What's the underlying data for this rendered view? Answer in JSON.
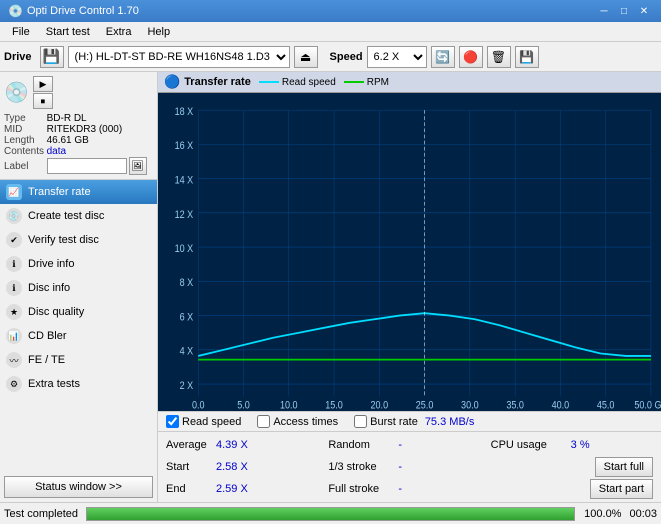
{
  "titlebar": {
    "title": "Opti Drive Control 1.70",
    "icon": "💿",
    "controls": [
      "—",
      "□",
      "✕"
    ]
  },
  "menubar": {
    "items": [
      "File",
      "Start test",
      "Extra",
      "Help"
    ]
  },
  "toolbar": {
    "drive_label": "Drive",
    "drive_value": "(H:) HL-DT-ST BD-RE  WH16NS48 1.D3",
    "speed_label": "Speed",
    "speed_value": "6.2 X"
  },
  "disc": {
    "type_label": "Type",
    "type_value": "BD-R DL",
    "mid_label": "MID",
    "mid_value": "RITEKDR3 (000)",
    "length_label": "Length",
    "length_value": "46.61 GB",
    "contents_label": "Contents",
    "contents_value": "data",
    "label_label": "Label",
    "label_value": ""
  },
  "nav": {
    "items": [
      {
        "id": "transfer-rate",
        "label": "Transfer rate",
        "active": true
      },
      {
        "id": "create-test-disc",
        "label": "Create test disc",
        "active": false
      },
      {
        "id": "verify-test-disc",
        "label": "Verify test disc",
        "active": false
      },
      {
        "id": "drive-info",
        "label": "Drive info",
        "active": false
      },
      {
        "id": "disc-info",
        "label": "Disc info",
        "active": false
      },
      {
        "id": "disc-quality",
        "label": "Disc quality",
        "active": false
      },
      {
        "id": "cd-bler",
        "label": "CD Bler",
        "active": false
      },
      {
        "id": "fe-te",
        "label": "FE / TE",
        "active": false
      },
      {
        "id": "extra-tests",
        "label": "Extra tests",
        "active": false
      }
    ],
    "status_btn": "Status window >>"
  },
  "chart": {
    "title": "Transfer rate",
    "legend": [
      {
        "label": "Read speed",
        "color": "#00ddff"
      },
      {
        "label": "RPM",
        "color": "#00cc00"
      }
    ],
    "y_axis": [
      "18 X",
      "16 X",
      "14 X",
      "12 X",
      "10 X",
      "8 X",
      "6 X",
      "4 X",
      "2 X",
      "0.0"
    ],
    "x_axis": [
      "0.0",
      "5.0",
      "10.0",
      "15.0",
      "20.0",
      "25.0",
      "30.0",
      "35.0",
      "40.0",
      "45.0",
      "50.0 GB"
    ],
    "read_speed_peak": "6 X",
    "rpm_line": "2 X"
  },
  "checkboxes": {
    "read_speed": {
      "label": "Read speed",
      "checked": true
    },
    "access_times": {
      "label": "Access times",
      "checked": false
    },
    "burst_rate": {
      "label": "Burst rate",
      "checked": false,
      "value": "75.3 MB/s"
    }
  },
  "stats": {
    "row1": {
      "avg_label": "Average",
      "avg_value": "4.39 X",
      "random_label": "Random",
      "random_value": "-",
      "cpu_label": "CPU usage",
      "cpu_value": "3 %"
    },
    "row2": {
      "start_label": "Start",
      "start_value": "2.58 X",
      "stroke1_label": "1/3 stroke",
      "stroke1_value": "-",
      "btn": "Start full"
    },
    "row3": {
      "end_label": "End",
      "end_value": "2.59 X",
      "stroke2_label": "Full stroke",
      "stroke2_value": "-",
      "btn": "Start part"
    }
  },
  "statusbar": {
    "text": "Test completed",
    "progress": 100,
    "pct": "100.0%",
    "time": "00:03"
  }
}
